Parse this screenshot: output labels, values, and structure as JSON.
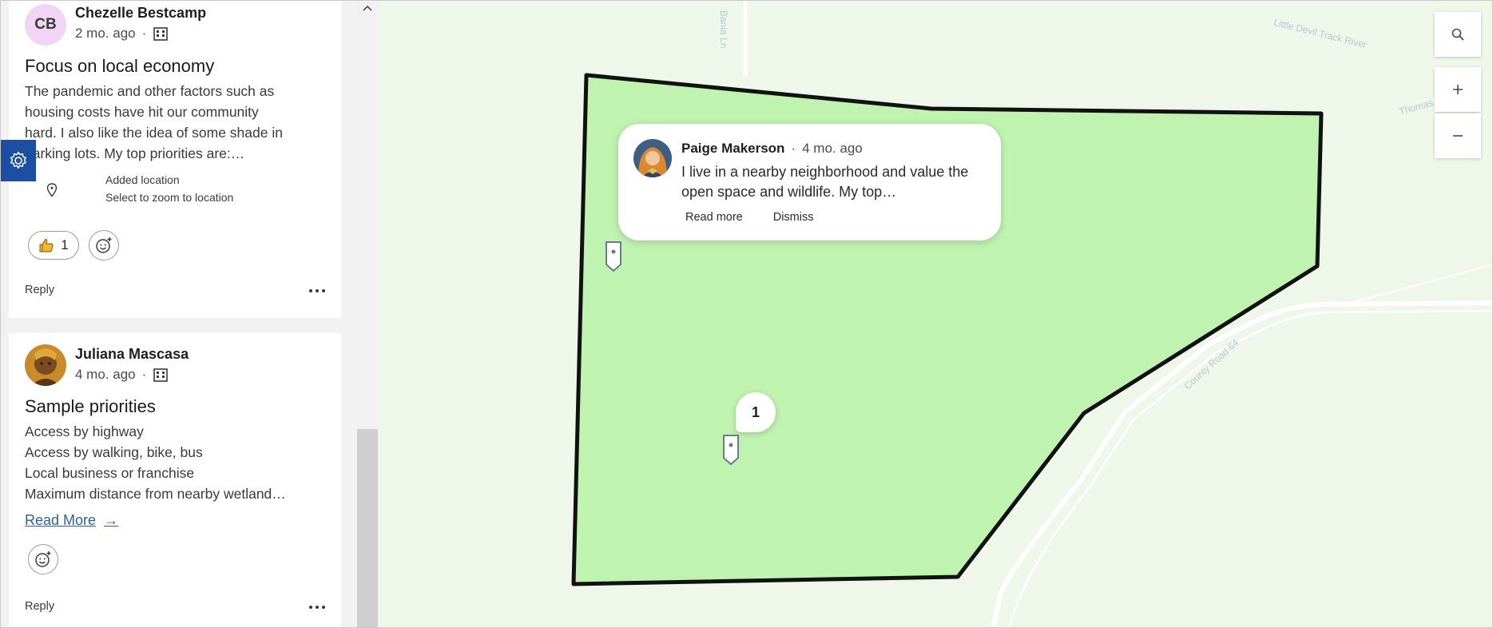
{
  "posts": [
    {
      "initials": "CB",
      "author": "Chezelle Bestcamp",
      "time": "2 mo. ago",
      "separator": "·",
      "title": "Focus on local economy",
      "body_lines": [
        "The pandemic and other factors such as",
        "housing costs have hit our community",
        "hard. I also like the idea of some shade in",
        "parking lots. My top priorities are:…"
      ],
      "location_label": "Added location",
      "location_hint": "Select to zoom to location",
      "like_count": "1",
      "reply_label": "Reply"
    },
    {
      "author": "Juliana Mascasa",
      "time": "4 mo. ago",
      "separator": "·",
      "title": "Sample priorities",
      "body_lines": [
        "Access by highway",
        "Access by walking, bike, bus",
        "Local business or franchise",
        "Maximum distance from nearby wetland…"
      ],
      "read_more": "Read More",
      "read_more_arrow": "→",
      "reply_label": "Reply"
    }
  ],
  "popup": {
    "author": "Paige Makerson",
    "separator": "·",
    "time": "4 mo. ago",
    "text": "I live in a nearby neighborhood and value the open space and wildlife. My top…",
    "read_more": "Read more",
    "dismiss": "Dismiss"
  },
  "map": {
    "cluster_count": "1",
    "labels": {
      "creek": "Little Devil Track River",
      "lane": "Bania Ln",
      "thomas": "Thomas",
      "county_road": "County Road 64"
    },
    "colors": {
      "polygon_fill": "#c0f3b0",
      "polygon_stroke": "#111111",
      "background": "#eef7ea",
      "road": "#ffffff",
      "accent": "#1a4fa3"
    }
  },
  "icons": {
    "settings": "gear-icon",
    "search": "search-icon",
    "zoom_in": "plus-icon",
    "zoom_out": "minus-icon",
    "location": "map-pin-icon",
    "like": "thumbs-up-icon",
    "add_reaction": "smiley-plus-icon",
    "more": "ellipsis-icon",
    "building": "building-icon",
    "scroll_up": "chevron-up-icon"
  }
}
